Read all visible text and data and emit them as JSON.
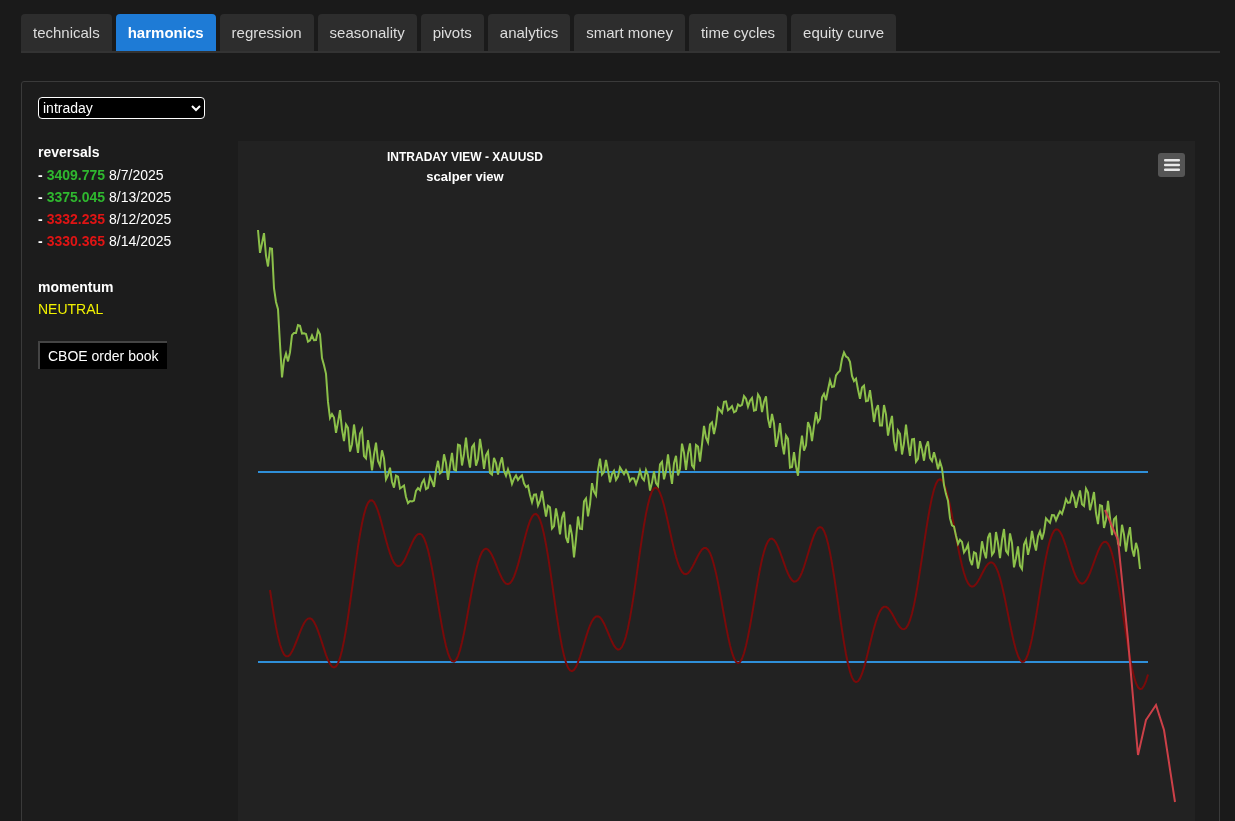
{
  "tabs": [
    {
      "label": "technicals",
      "selected": false
    },
    {
      "label": "harmonics",
      "selected": true
    },
    {
      "label": "regression",
      "selected": false
    },
    {
      "label": "seasonality",
      "selected": false
    },
    {
      "label": "pivots",
      "selected": false
    },
    {
      "label": "analytics",
      "selected": false
    },
    {
      "label": "smart money",
      "selected": false
    },
    {
      "label": "time cycles",
      "selected": false
    },
    {
      "label": "equity curve",
      "selected": false
    }
  ],
  "timeframe_select": {
    "value": "intraday"
  },
  "reversals": {
    "title": "reversals",
    "items": [
      {
        "prefix": "-",
        "price": "3409.775",
        "date": "8/7/2025",
        "color": "#2fb82f"
      },
      {
        "prefix": "-",
        "price": "3375.045",
        "date": "8/13/2025",
        "color": "#2fb82f"
      },
      {
        "prefix": "-",
        "price": "3332.235",
        "date": "8/12/2025",
        "color": "#e01414"
      },
      {
        "prefix": "-",
        "price": "3330.365",
        "date": "8/14/2025",
        "color": "#e01414"
      }
    ]
  },
  "momentum": {
    "title": "momentum",
    "value": "NEUTRAL"
  },
  "order_book_button": "CBOE order book",
  "chart": {
    "title": "INTRADAY VIEW - XAUUSD",
    "subtitle": "scalper view"
  }
}
